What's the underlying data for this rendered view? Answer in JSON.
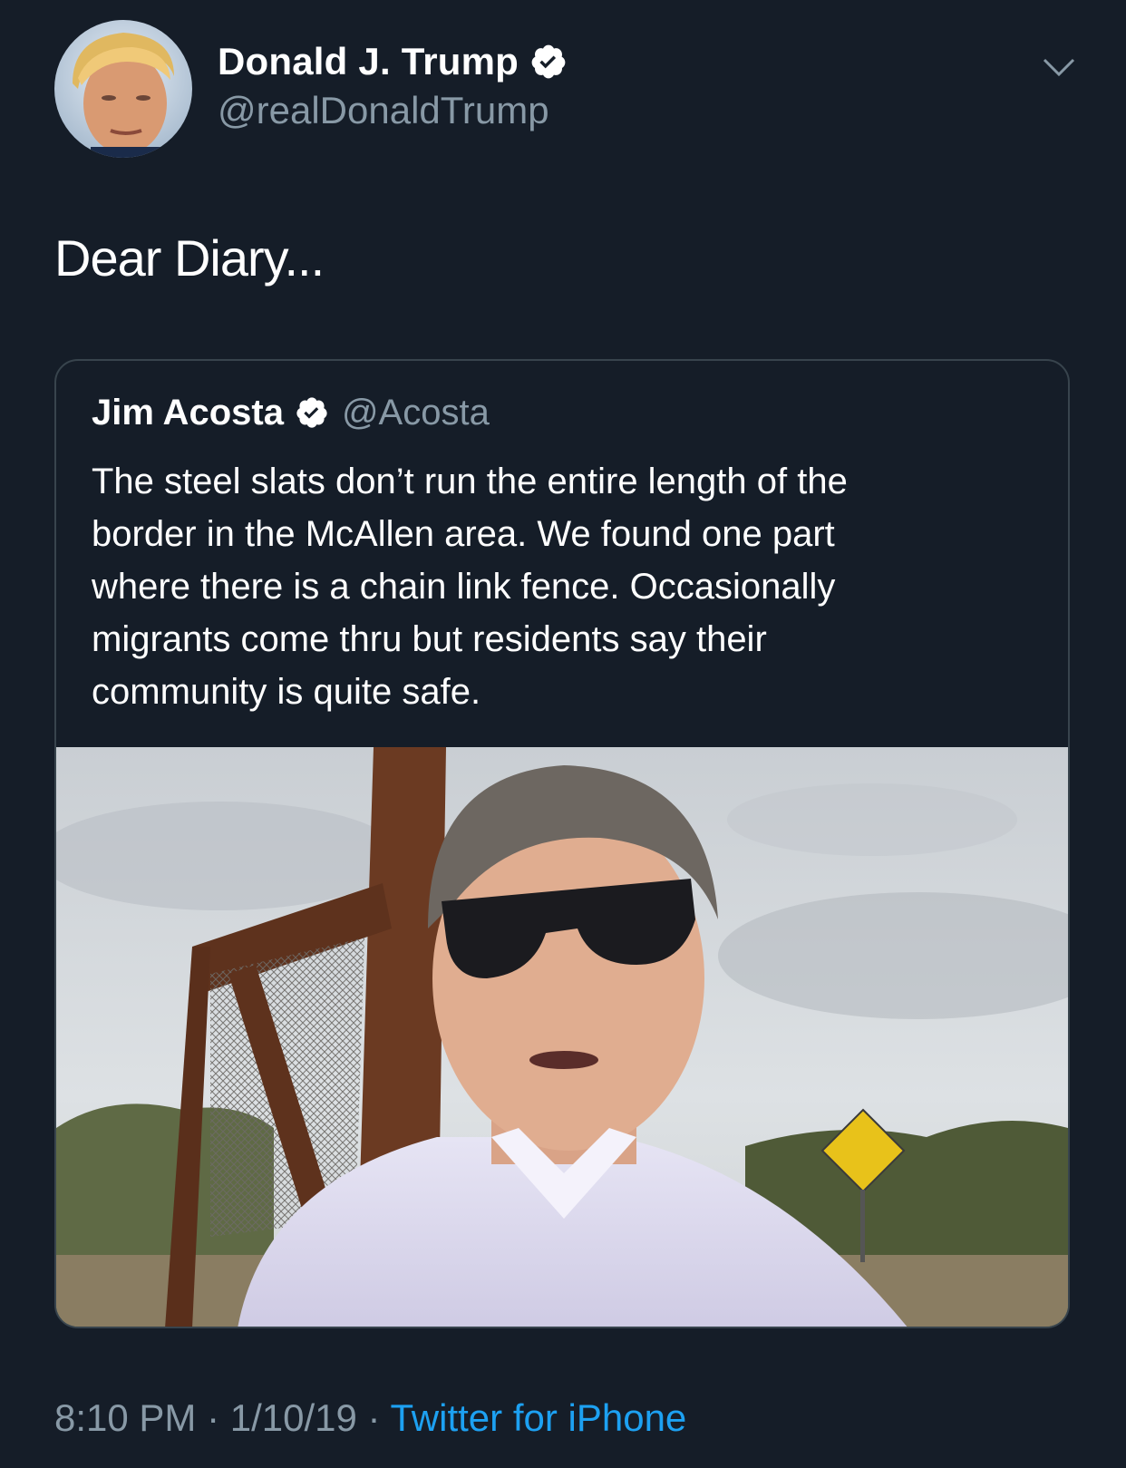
{
  "author": {
    "name": "Donald J. Trump",
    "handle": "@realDonaldTrump",
    "avatar_icon": "profile-photo"
  },
  "tweet": {
    "text": "Dear Diary..."
  },
  "quoted_tweet": {
    "name": "Jim Acosta",
    "handle": "@Acosta",
    "text_lines": [
      "The steel slats don’t run the entire length of the",
      "border in the McAllen area. We found one part",
      "where there is a chain link fence. Occasionally",
      "migrants come thru but residents say their",
      "community is quite safe."
    ],
    "media": "video-thumbnail"
  },
  "meta": {
    "time": "8:10 PM",
    "separator_1": " · ",
    "date": "1/10/19",
    "separator_2": " · ",
    "source": "Twitter for iPhone"
  },
  "colors": {
    "background": "#151d28",
    "secondary_text": "#8899a6",
    "link": "#1da1f2",
    "border": "#38444d"
  },
  "icons": {
    "verified": "verified-badge-icon",
    "menu": "chevron-down-icon"
  }
}
